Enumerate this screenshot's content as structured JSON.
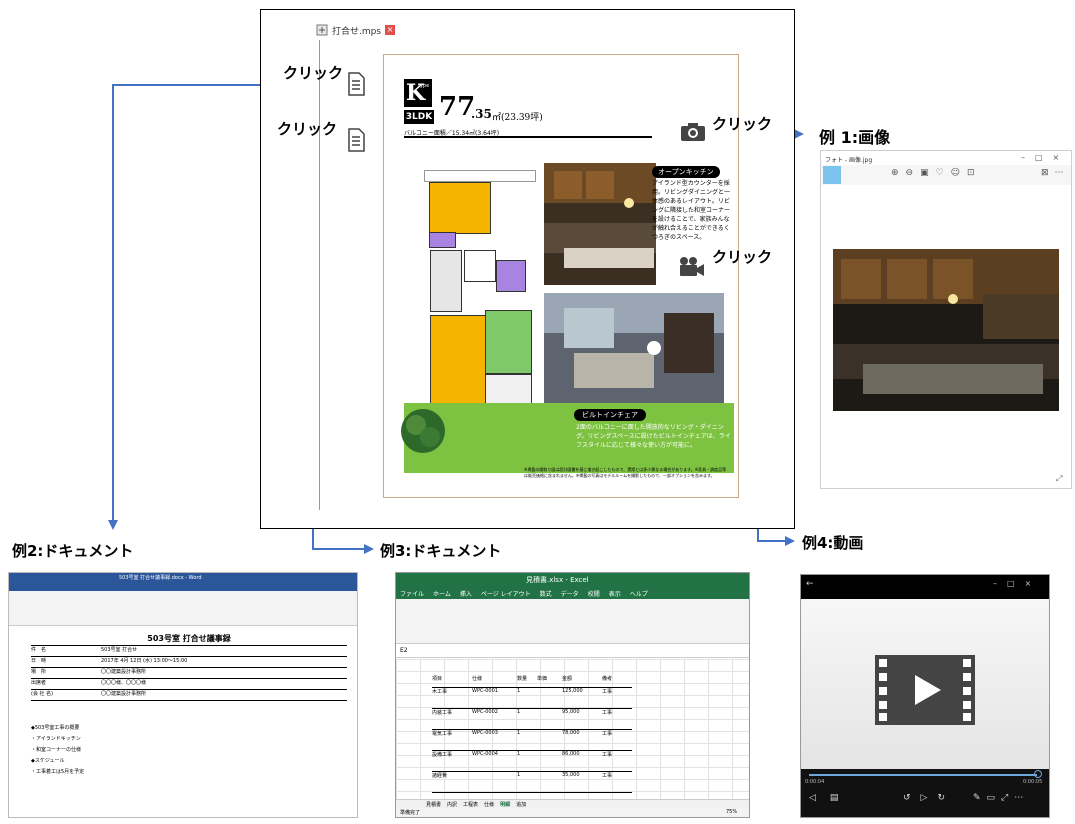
{
  "viewer": {
    "tab_title": "打合せ.mps",
    "plan": {
      "type_letter": "K",
      "type_suffix": "type",
      "layout": "3LDK",
      "area_int": "77",
      "area_dec": ".35",
      "area_unit": "㎡(23.39坪)",
      "balcony": "バルコニー面積／15.34㎡(3.64坪)",
      "open_kitchen_title": "オープンキッチン",
      "open_kitchen_desc": "アイランド型カウンターを採用。リビングダイニングと一体感のあるレイアウト。リビングに隣接した和室コーナーを設けることで、家族みんなが触れ合えることができるくつろぎのスペース。",
      "builtin_title": "ビルトインチェア",
      "builtin_desc": "2面のバルコニーに面した開放的なリビング・ダイニング。リビングスペースに設けたビルトインチェアは、ライフスタイルに応じて様々な使い方が可能に。",
      "notes": "※掲載の間取り図は設計図書を基に描き起こしたもので、実際とは多少異なる場合があります。※家具・調度品等は販売価格に含まれません。※掲載の写真はモデルルームを撮影したもので、一部オプションを含みます。"
    }
  },
  "labels": {
    "click1": "クリック",
    "click2": "クリック",
    "click3": "クリック",
    "click4": "クリック",
    "ex1": "例 1:画像",
    "ex2": "例2:ドキュメント",
    "ex3": "例3:ドキュメント",
    "ex4": "例4:動画"
  },
  "image_viewer": {
    "title": "フォト - 画像.jpg"
  },
  "word": {
    "title": "503号室 打合せ議事録.docx - Word",
    "doc_title": "503号室 打合せ議事録",
    "rows": [
      {
        "key": "件　名",
        "val": "503号室 打合せ"
      },
      {
        "key": "日　時",
        "val": "2017年 4月 12日 (水) 13:00～15:00"
      },
      {
        "key": "場　所",
        "val": "〇〇建築設計事務所"
      },
      {
        "key": "出席者",
        "val": "〇〇〇様、〇〇〇様"
      },
      {
        "key": "(会 社 名)",
        "val": "〇〇建築設計事務所"
      }
    ],
    "body": [
      "◆503号室工事の概要",
      "・アイランドキッチン",
      "・和室コーナーの仕様",
      "◆スケジュール",
      "・工事着工は5月を予定"
    ]
  },
  "excel": {
    "title": "見積書.xlsx - Excel",
    "tabs": [
      "ファイル",
      "ホーム",
      "挿入",
      "ページ レイアウト",
      "数式",
      "データ",
      "校閲",
      "表示",
      "ヘルプ"
    ],
    "cell_ref": "E2",
    "header": [
      "項目",
      "仕様",
      "数量",
      "単価",
      "金額",
      "備考"
    ],
    "rows": [
      [
        "木工事",
        "WPC-0001",
        "1",
        "",
        "125,000",
        "工事"
      ],
      [
        "内装工事",
        "WPC-0002",
        "1",
        "",
        "95,000",
        "工事"
      ],
      [
        "電気工事",
        "WPC-0003",
        "1",
        "",
        "78,000",
        "工事"
      ],
      [
        "設備工事",
        "WPC-0004",
        "1",
        "",
        "86,000",
        "工事"
      ],
      [
        "諸経費",
        "",
        "1",
        "",
        "35,000",
        "工事"
      ]
    ],
    "sheet_tabs": [
      "見積書",
      "内訳",
      "工程表",
      "仕様",
      "明細",
      "追加"
    ],
    "status": "準備完了",
    "zoom": "75%"
  },
  "video": {
    "time_left": "0:00:04",
    "time_right": "0:00:05"
  },
  "colors": {
    "arrow": "#4472c4",
    "excel_green": "#217346",
    "word_blue": "#2b579a",
    "grass": "#7ec242",
    "floor_yellow": "#f5b400",
    "floor_purple": "#a983e0",
    "floor_green": "#7fc96a"
  }
}
